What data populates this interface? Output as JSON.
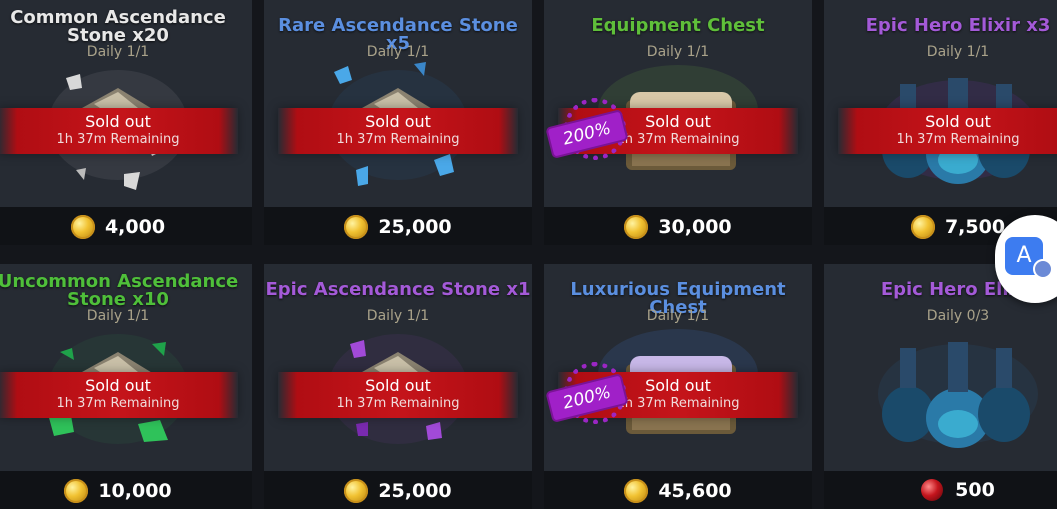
{
  "shop": {
    "items": [
      {
        "title": "Common Ascendance Stone x20",
        "title_color": "#e8e8e8",
        "daily": "Daily 1/1",
        "status": "Sold out",
        "remaining": "1h 37m Remaining",
        "price": "4,000",
        "currency_icon": "gold-coin-icon",
        "art_icon": "ascendance-stone-icon",
        "art_color": "#d8d8d8"
      },
      {
        "title": "Rare Ascendance Stone x5",
        "title_color": "#5b8fe0",
        "daily": "Daily 1/1",
        "status": "Sold out",
        "remaining": "1h 37m Remaining",
        "price": "25,000",
        "currency_icon": "gold-coin-icon",
        "art_icon": "ascendance-stone-icon",
        "art_color": "#4aa8e8"
      },
      {
        "title": "Equipment Chest",
        "title_color": "#5fbf3a",
        "daily": "Daily 1/1",
        "status": "Sold out",
        "remaining": "1h 37m Remaining",
        "price": "30,000",
        "currency_icon": "gold-coin-icon",
        "art_icon": "equipment-chest-icon",
        "art_color": "#7ad04a",
        "badge": "200%"
      },
      {
        "title": "Epic Hero Elixir x3",
        "title_color": "#a45ad8",
        "daily": "Daily 1/1",
        "status": "Sold out",
        "remaining": "1h 37m Remaining",
        "price": "7,500",
        "currency_icon": "gold-coin-icon",
        "art_icon": "elixir-bottles-icon",
        "art_color": "#3fb8d8"
      },
      {
        "title": "Uncommon Ascendance Stone x10",
        "title_color": "#4fbf3a",
        "daily": "Daily 1/1",
        "status": "Sold out",
        "remaining": "1h 37m Remaining",
        "price": "10,000",
        "currency_icon": "gold-coin-icon",
        "art_icon": "ascendance-stone-icon",
        "art_color": "#2fc25a"
      },
      {
        "title": "Epic Ascendance Stone x1",
        "title_color": "#a45ad8",
        "daily": "Daily 1/1",
        "status": "Sold out",
        "remaining": "1h 37m Remaining",
        "price": "25,000",
        "currency_icon": "gold-coin-icon",
        "art_icon": "ascendance-stone-icon",
        "art_color": "#a24ad8"
      },
      {
        "title": "Luxurious Equipment Chest",
        "title_color": "#5b8fe0",
        "daily": "Daily 1/1",
        "status": "Sold out",
        "remaining": "1h 37m Remaining",
        "price": "45,600",
        "currency_icon": "gold-coin-icon",
        "art_icon": "equipment-chest-icon",
        "art_color": "#4a8ae8",
        "badge": "200%"
      },
      {
        "title": "Epic Hero Elixir",
        "title_color": "#a45ad8",
        "daily": "Daily 0/3",
        "status": "",
        "remaining": "",
        "price": "500",
        "currency_icon": "red-gem-icon",
        "art_icon": "elixir-bottles-icon",
        "art_color": "#3fb8d8"
      }
    ]
  },
  "translate_button": {
    "label": "A",
    "icon": "translate-icon"
  }
}
